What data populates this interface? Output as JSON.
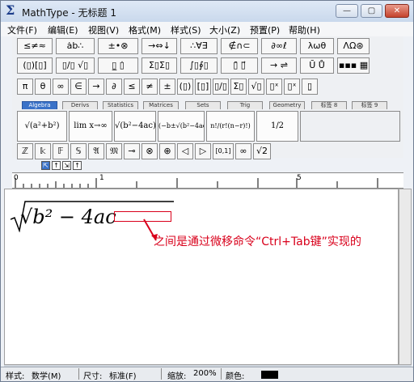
{
  "window": {
    "title": "MathType - 无标题 1",
    "controls": {
      "minimize": "—",
      "maximize": "▢",
      "close": "✕"
    }
  },
  "menu": [
    "文件(F)",
    "编辑(E)",
    "视图(V)",
    "格式(M)",
    "样式(S)",
    "大小(Z)",
    "预置(P)",
    "帮助(H)"
  ],
  "toolbar": {
    "row1": [
      "≤≠≈",
      "ȧb∴",
      "±•⊗",
      "→⇔↓",
      "∴∀∃",
      "∉∩⊂",
      "∂∞ℓ",
      "λωθ",
      "ΛΩ⊛"
    ],
    "row2": [
      "(▯)[▯]",
      "▯/▯ √▯",
      "▯̲ ▯̇",
      "Σ▯Σ▯",
      "∫▯∮▯",
      "▯̄ ▯⃗",
      "→ ⇌",
      "Ū Ů",
      "▪▪▪ ▦"
    ],
    "row3": [
      "π",
      "θ",
      "∞",
      "∈",
      "→",
      "∂",
      "≤",
      "≠",
      "±",
      "(▯)",
      "[▯]",
      "▯/▯",
      "Σ▯",
      "√▯",
      "▯ˣ",
      "▯ˣ",
      "▯̱"
    ],
    "tabs": [
      "Algebra",
      "Derivs",
      "Statistics",
      "Matrices",
      "Sets",
      "Trig",
      "Geometry",
      "标签 8",
      "标签 9"
    ],
    "row4": [
      "√(a²+b²)",
      "lim x→∞",
      "√(b²−4ac)",
      "(−b±√(b²−4ac))/2a",
      "n!/(r!(n−r)!)",
      "1/2"
    ],
    "row5": [
      "ℤ",
      "𝕜",
      "𝔽",
      "𝕊",
      "𝔄",
      "𝔐",
      "⊸",
      "⊗",
      "⊕",
      "◁",
      "▷",
      "[0,1]",
      "∞",
      "√2"
    ],
    "tiny_tools": [
      "⇱",
      "↑",
      "⇲",
      "↑"
    ]
  },
  "ruler": {
    "marks": [
      "0",
      "1",
      "5"
    ]
  },
  "editor": {
    "formula": "√b² − 4ac",
    "annotation": "之间是通过微移命令“Ctrl+Tab键”实现的"
  },
  "status": {
    "style_label": "样式:",
    "style_value": "数学(M)",
    "size_label": "尺寸:",
    "size_value": "标准(F)",
    "zoom_label": "缩放:",
    "zoom_value": "200%",
    "color_label": "颜色:",
    "color_value": "#000000"
  },
  "colors": {
    "annotation": "#d9001b",
    "tab_active": "#3a72c8"
  }
}
